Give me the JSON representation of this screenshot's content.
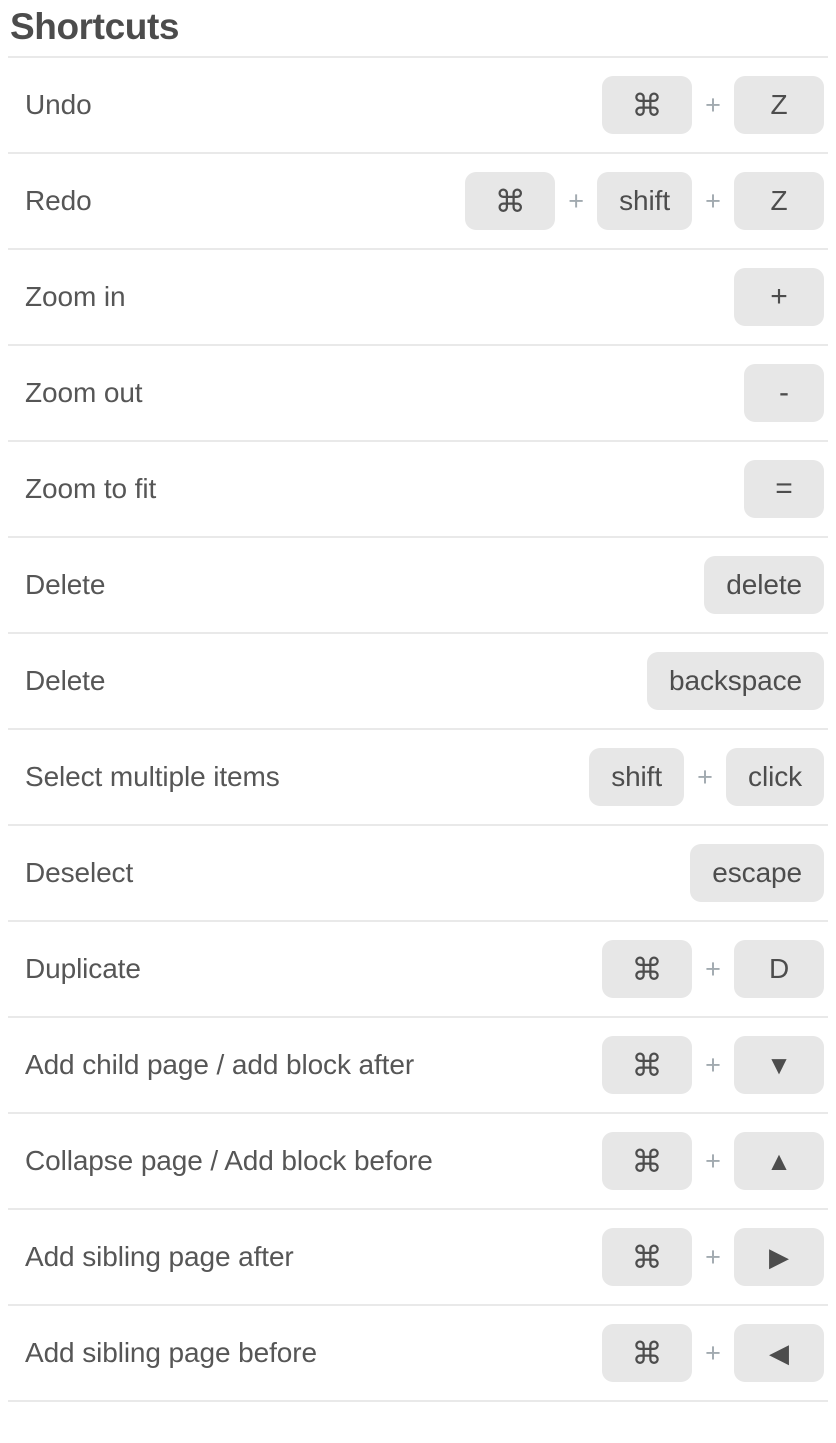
{
  "panel": {
    "title": "Shortcuts",
    "separator_label": "+"
  },
  "shortcuts": [
    {
      "action": "Undo",
      "keys": [
        "⌘",
        "Z"
      ]
    },
    {
      "action": "Redo",
      "keys": [
        "⌘",
        "shift",
        "Z"
      ]
    },
    {
      "action": "Zoom in",
      "keys": [
        "+"
      ]
    },
    {
      "action": "Zoom out",
      "keys": [
        "-"
      ]
    },
    {
      "action": "Zoom to fit",
      "keys": [
        "="
      ]
    },
    {
      "action": "Delete",
      "keys": [
        "delete"
      ]
    },
    {
      "action": "Delete",
      "keys": [
        "backspace"
      ]
    },
    {
      "action": "Select multiple items",
      "keys": [
        "shift",
        "click"
      ]
    },
    {
      "action": "Deselect",
      "keys": [
        "escape"
      ]
    },
    {
      "action": "Duplicate",
      "keys": [
        "⌘",
        "D"
      ]
    },
    {
      "action": "Add child page / add block after",
      "keys": [
        "⌘",
        "▼"
      ]
    },
    {
      "action": "Collapse page / Add block before",
      "keys": [
        "⌘",
        "▲"
      ]
    },
    {
      "action": "Add sibling page after",
      "keys": [
        "⌘",
        "▶"
      ]
    },
    {
      "action": "Add sibling page before",
      "keys": [
        "⌘",
        "◀"
      ]
    }
  ],
  "colors": {
    "keycap_bg": "#e7e7e7",
    "keycap_text": "#4d4d4d",
    "label_text": "#565656",
    "title_text": "#4c4c4c",
    "separator_line": "#e9e9e9",
    "plus_text": "#a2aab0",
    "background": "#ffffff"
  }
}
